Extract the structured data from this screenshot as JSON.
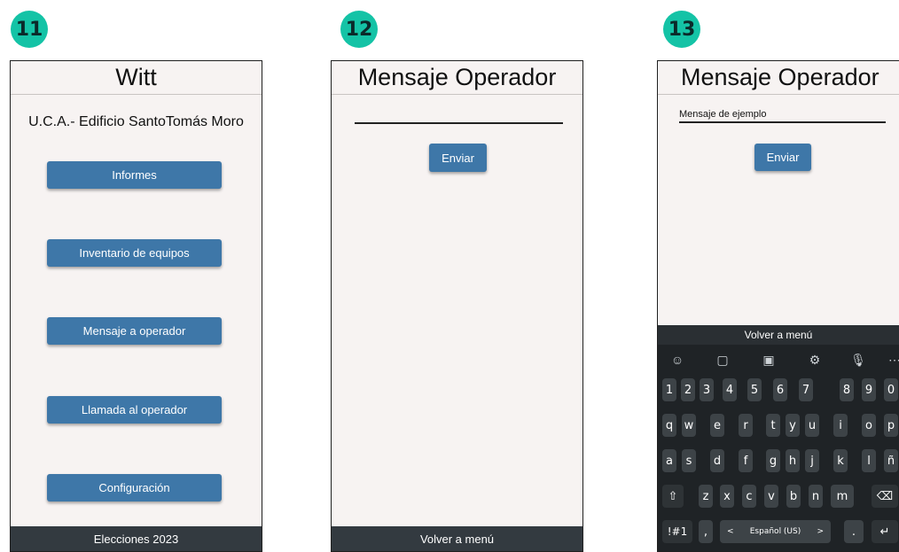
{
  "badges": [
    "11",
    "12",
    "13"
  ],
  "screen11": {
    "title": "Witt",
    "subtitle": "U.C.A.- Edificio SantoTomás Moro",
    "buttons": [
      "Informes",
      "Inventario de equipos",
      "Mensaje a operador",
      "Llamada al operador",
      "Configuración"
    ],
    "footer": "Elecciones 2023"
  },
  "screen12": {
    "title": "Mensaje Operador",
    "input_value": "",
    "send_label": "Enviar",
    "footer": "Volver a menú"
  },
  "screen13": {
    "title": "Mensaje Operador",
    "input_value": "Mensaje de ejemplo",
    "send_label": "Enviar",
    "footer": "Volver a menú"
  },
  "keyboard": {
    "toolbar_icons": [
      "emoji-icon",
      "clipboard-icon",
      "sticker-icon",
      "settings-icon",
      "microphone-icon",
      "more-icon"
    ],
    "toolbar_glyphs": [
      "☺",
      "▢",
      "▣",
      "⚙",
      "🎙",
      "⋯"
    ],
    "row1": [
      "1",
      "2",
      "3",
      "4",
      "5",
      "6",
      "7",
      "8",
      "9",
      "0"
    ],
    "row2": [
      "q",
      "w",
      "e",
      "r",
      "t",
      "y",
      "u",
      "i",
      "o",
      "p"
    ],
    "row3": [
      "a",
      "s",
      "d",
      "f",
      "g",
      "h",
      "j",
      "k",
      "l",
      "ñ"
    ],
    "row4": [
      "⇧",
      "z",
      "x",
      "c",
      "v",
      "b",
      "n",
      "m",
      "⌫"
    ],
    "row5": {
      "symbols": "!#1",
      "comma": ",",
      "lang_left": "<",
      "space": "Español (US)",
      "lang_right": ">",
      "period": ".",
      "enter": "↵"
    }
  }
}
